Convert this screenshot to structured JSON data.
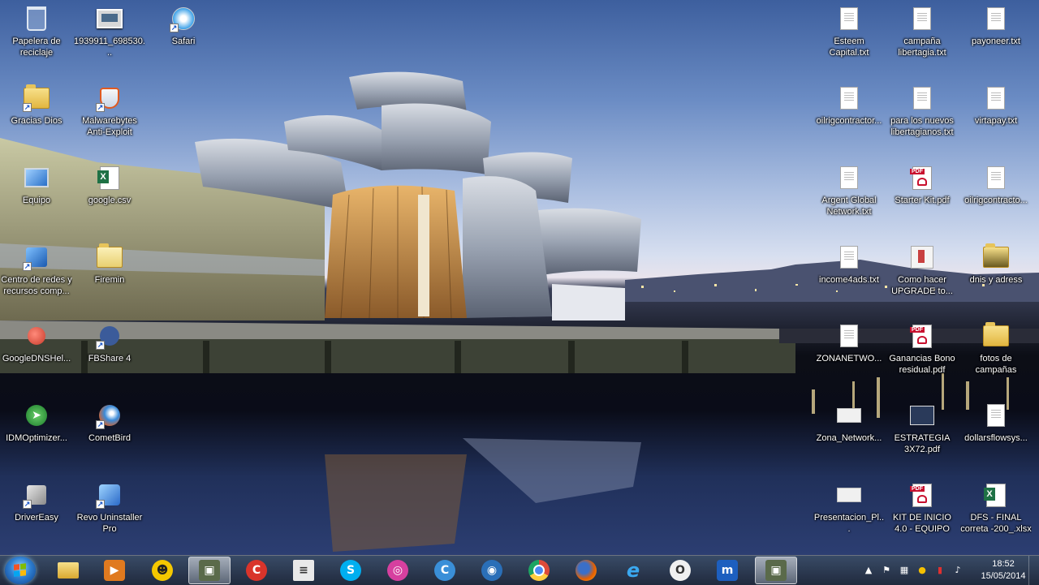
{
  "desktop": {
    "icons": [
      {
        "id": "recycle",
        "label": "Papelera de reciclaje",
        "icon": "recycle-bin-icon"
      },
      {
        "id": "img",
        "label": "1939911_698530...",
        "icon": "image-file-icon"
      },
      {
        "id": "safari",
        "label": "Safari",
        "icon": "safari-icon"
      },
      {
        "id": "gracias",
        "label": "Gracias Dios",
        "icon": "folder-icon"
      },
      {
        "id": "malwarebytes",
        "label": "Malwarebytes Anti-Exploit",
        "icon": "malwarebytes-icon"
      },
      {
        "id": "equipo",
        "label": "Equipo",
        "icon": "computer-icon"
      },
      {
        "id": "googlecsv",
        "label": "google.csv",
        "icon": "excel-file-icon"
      },
      {
        "id": "centro",
        "label": "Centro de redes y recursos comp...",
        "icon": "network-center-icon"
      },
      {
        "id": "firemin",
        "label": "Firemin",
        "icon": "folder-icon"
      },
      {
        "id": "googledns",
        "label": "GoogleDNSHel...",
        "icon": "globe-icon"
      },
      {
        "id": "fbshare",
        "label": "FBShare 4",
        "icon": "fbshare-icon"
      },
      {
        "id": "idm",
        "label": "IDMOptimizer...",
        "icon": "idm-optimizer-icon"
      },
      {
        "id": "cometbird",
        "label": "CometBird",
        "icon": "cometbird-icon"
      },
      {
        "id": "drivereasy",
        "label": "DriverEasy",
        "icon": "drivereasy-icon"
      },
      {
        "id": "revo",
        "label": "Revo Uninstaller Pro",
        "icon": "revo-uninstaller-icon"
      },
      {
        "id": "esteem",
        "label": "Esteem Capital.txt",
        "icon": "text-file-icon"
      },
      {
        "id": "campana",
        "label": "campaña libertagia.txt",
        "icon": "text-file-icon"
      },
      {
        "id": "payoneer",
        "label": "payoneer.txt",
        "icon": "text-file-icon"
      },
      {
        "id": "oilrig1",
        "label": "oilrigcontractor...",
        "icon": "text-file-icon"
      },
      {
        "id": "paralos",
        "label": "para los nuevos libertagianos.txt",
        "icon": "text-file-icon"
      },
      {
        "id": "virtapay",
        "label": "virtapay.txt",
        "icon": "text-file-icon"
      },
      {
        "id": "argent",
        "label": "Argent Global Network.txt",
        "icon": "text-file-icon"
      },
      {
        "id": "starterkit",
        "label": "Starter Kit.pdf",
        "icon": "pdf-file-icon"
      },
      {
        "id": "oilrig2",
        "label": "oilrigcontracto...",
        "icon": "text-file-icon"
      },
      {
        "id": "income4ads",
        "label": "income4ads.txt",
        "icon": "text-file-icon"
      },
      {
        "id": "comohacer",
        "label": "Como hacer UPGRADE to...",
        "icon": "document-icon"
      },
      {
        "id": "dnis",
        "label": "dnis y adress",
        "icon": "folder-icon"
      },
      {
        "id": "zonanetwo",
        "label": "ZONANETWO...",
        "icon": "text-file-icon"
      },
      {
        "id": "ganancias",
        "label": "Ganancias Bono residual.pdf",
        "icon": "pdf-file-icon"
      },
      {
        "id": "fotos",
        "label": "fotos de campañas",
        "icon": "folder-icon"
      },
      {
        "id": "zonanetwork",
        "label": "Zona_Network...",
        "icon": "image-file-icon"
      },
      {
        "id": "estrategia",
        "label": "ESTRATEGIA 3X72.pdf",
        "icon": "pdf-file-icon"
      },
      {
        "id": "dollarsflow",
        "label": "dollarsflowsys...",
        "icon": "text-file-icon"
      },
      {
        "id": "presentacion",
        "label": "Presentacion_Pl...",
        "icon": "image-file-icon"
      },
      {
        "id": "kitinicio",
        "label": "KIT DE INICIO 4.0 - EQUIPO GLO...",
        "icon": "pdf-file-icon"
      },
      {
        "id": "dfsfinal",
        "label": "DFS - FINAL correta -200_.xlsx",
        "icon": "excel-file-icon"
      }
    ]
  },
  "taskbar": {
    "pinned": [
      {
        "name": "file-explorer",
        "icon": "folder-icon",
        "color": "#e3b84a",
        "glyph": ""
      },
      {
        "name": "media-player",
        "icon": "media-player-icon",
        "color": "#e07a1f",
        "glyph": "▶"
      },
      {
        "name": "cyberghost",
        "icon": "cyberghost-icon",
        "color": "#f5c800",
        "glyph": "☻"
      },
      {
        "name": "active-app",
        "icon": "app-window-icon",
        "color": "#5a6a4a",
        "glyph": "▣"
      },
      {
        "name": "ccleaner",
        "icon": "ccleaner-icon",
        "color": "#d9342b",
        "glyph": "C"
      },
      {
        "name": "notepad",
        "icon": "notepad-icon",
        "color": "#e9e9e9",
        "glyph": "≡"
      },
      {
        "name": "skype",
        "icon": "skype-icon",
        "color": "#00aff0",
        "glyph": "S"
      },
      {
        "name": "swirl-app",
        "icon": "swirl-icon",
        "color": "#d6409f",
        "glyph": "◎"
      },
      {
        "name": "ccleaner-browser",
        "icon": "c-browser-icon",
        "color": "#3a8fd8",
        "glyph": "C"
      },
      {
        "name": "vpn-globe",
        "icon": "globe-icon",
        "color": "#2a6fb8",
        "glyph": "◉"
      },
      {
        "name": "chrome",
        "icon": "chrome-icon",
        "color": "#dd4b39",
        "glyph": "◉"
      },
      {
        "name": "firefox",
        "icon": "firefox-icon",
        "color": "#e66000",
        "glyph": "◐"
      },
      {
        "name": "internet-explorer",
        "icon": "internet-explorer-icon",
        "color": "#1f8fe0",
        "glyph": "e"
      },
      {
        "name": "opera",
        "icon": "opera-icon",
        "color": "#f0f0f0",
        "glyph": "O"
      },
      {
        "name": "maxthon",
        "icon": "maxthon-icon",
        "color": "#1d5fbf",
        "glyph": "m"
      },
      {
        "name": "active-app-2",
        "icon": "app-window-icon",
        "color": "#5a6a4a",
        "glyph": "▣"
      }
    ],
    "clock": {
      "time": "18:52",
      "date": "15/05/2014"
    }
  }
}
